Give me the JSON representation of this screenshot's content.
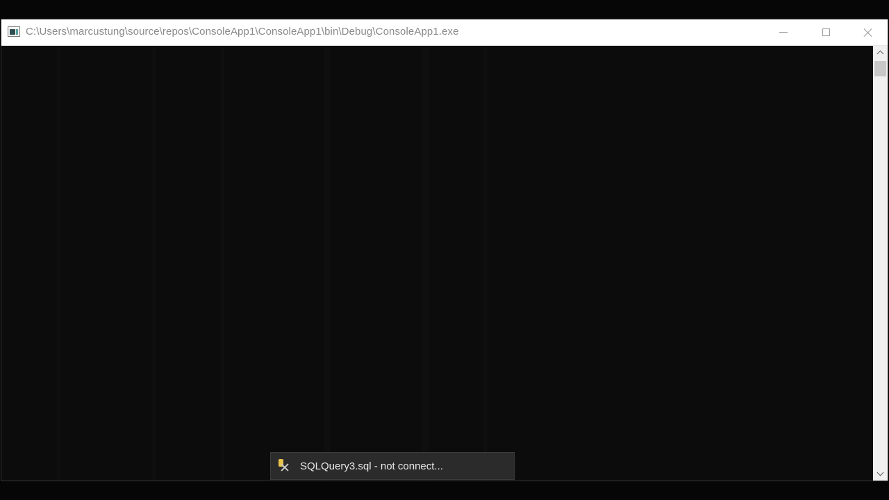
{
  "window": {
    "title": "C:\\Users\\marcustung\\source\\repos\\ConsoleApp1\\ConsoleApp1\\bin\\Debug\\ConsoleApp1.exe",
    "app_icon": "console-window-icon",
    "controls": {
      "minimize_icon": "minimize-icon",
      "maximize_icon": "maximize-icon",
      "close_icon": "close-icon"
    }
  },
  "console": {
    "background_color": "#0c0c0c"
  },
  "taskbar_tooltip": {
    "icon": "sql-query-tool-icon",
    "label": "SQLQuery3.sql - not connect..."
  },
  "scrollbar": {
    "up_icon": "scroll-up-icon",
    "down_icon": "scroll-down-icon"
  }
}
